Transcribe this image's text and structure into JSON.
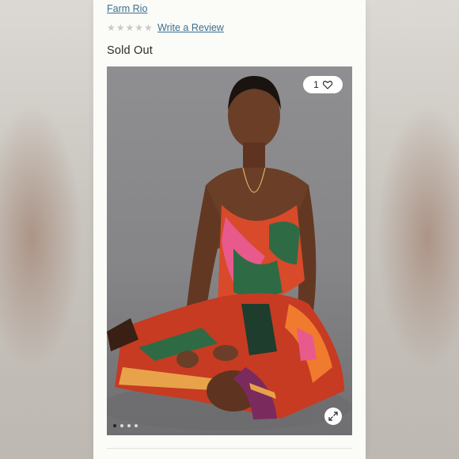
{
  "product": {
    "brand": "Farm Rio",
    "rating_stars": "★★★★★",
    "review_link": "Write a Review",
    "status": "Sold Out"
  },
  "gallery": {
    "like_count": "1",
    "icons": {
      "like": "heart-icon",
      "expand": "expand-icon"
    },
    "dot_count": 4,
    "active_dot": 0
  },
  "colors": {
    "link": "#3a6f8f",
    "panel": "#fbfbf8",
    "photo_backdrop": "#88888b",
    "dress_red": "#d84a2a",
    "dress_green": "#2e6b45",
    "dress_pink": "#e85a8c",
    "skin": "#6b3e27"
  }
}
